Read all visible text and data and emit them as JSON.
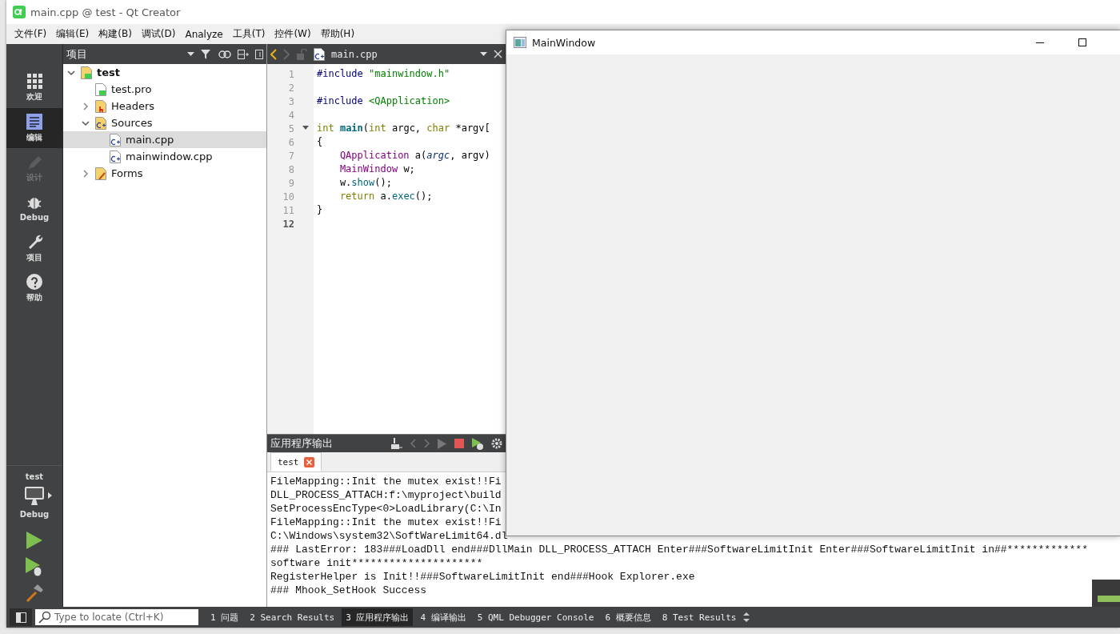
{
  "window": {
    "title": "main.cpp @ test - Qt Creator"
  },
  "menu": [
    "文件(F)",
    "编辑(E)",
    "构建(B)",
    "调试(D)",
    "Analyze",
    "工具(T)",
    "控件(W)",
    "帮助(H)"
  ],
  "mode_bar": {
    "modes": [
      {
        "label": "欢迎",
        "kind": "welcome",
        "selected": false,
        "disabled": false
      },
      {
        "label": "编辑",
        "kind": "edit",
        "selected": true,
        "disabled": false
      },
      {
        "label": "设计",
        "kind": "design",
        "selected": false,
        "disabled": true
      },
      {
        "label": "Debug",
        "kind": "debug",
        "selected": false,
        "disabled": false
      },
      {
        "label": "项目",
        "kind": "projects",
        "selected": false,
        "disabled": false
      },
      {
        "label": "帮助",
        "kind": "help",
        "selected": false,
        "disabled": false
      }
    ],
    "target": {
      "project": "test",
      "build": "Debug"
    }
  },
  "projects_pane": {
    "title": "项目",
    "tree": [
      {
        "label": "test",
        "kind": "project",
        "expanded": true,
        "selected": false,
        "children": [
          {
            "label": "test.pro",
            "kind": "pro",
            "selected": false
          },
          {
            "label": "Headers",
            "kind": "headers",
            "expanded": false,
            "selected": false
          },
          {
            "label": "Sources",
            "kind": "sources",
            "expanded": true,
            "selected": false,
            "children": [
              {
                "label": "main.cpp",
                "kind": "cpp",
                "selected": true
              },
              {
                "label": "mainwindow.cpp",
                "kind": "cpp",
                "selected": false
              }
            ]
          },
          {
            "label": "Forms",
            "kind": "forms",
            "expanded": false,
            "selected": false
          }
        ]
      }
    ]
  },
  "editor": {
    "file": "main.cpp",
    "lines": [
      {
        "number": "1",
        "current": false,
        "foldable": false,
        "tokens": [
          {
            "t": "#include ",
            "kind": "pre"
          },
          {
            "t": "\"mainwindow.h\"",
            "kind": "str"
          }
        ]
      },
      {
        "number": "2",
        "current": false,
        "foldable": false
      },
      {
        "number": "3",
        "current": false,
        "foldable": false,
        "tokens": [
          {
            "t": "#include ",
            "kind": "pre"
          },
          {
            "t": "<QApplication>",
            "kind": "str"
          }
        ]
      },
      {
        "number": "4",
        "current": false,
        "foldable": false
      },
      {
        "number": "5",
        "current": false,
        "foldable": true,
        "tokens": [
          {
            "t": "int ",
            "kind": "kw"
          },
          {
            "t": "main",
            "kind": "fn"
          },
          {
            "t": "(",
            "kind": "plain"
          },
          {
            "t": "int",
            "kind": "kw"
          },
          {
            "t": " argc, ",
            "kind": "plain"
          },
          {
            "t": "char",
            "kind": "kw"
          },
          {
            "t": " *argv[",
            "kind": "plain"
          }
        ]
      },
      {
        "number": "6",
        "current": false,
        "foldable": false,
        "tokens": [
          {
            "t": "{",
            "kind": "plain"
          }
        ]
      },
      {
        "number": "7",
        "current": false,
        "foldable": false,
        "tokens": [
          {
            "t": "    QApplication",
            "kind": "type"
          },
          {
            "t": " a(",
            "kind": "plain"
          },
          {
            "t": "argc",
            "kind": "param"
          },
          {
            "t": ", argv)",
            "kind": "plain"
          }
        ]
      },
      {
        "number": "8",
        "current": false,
        "foldable": false,
        "tokens": [
          {
            "t": "    MainWindow",
            "kind": "type"
          },
          {
            "t": " w;",
            "kind": "plain"
          }
        ]
      },
      {
        "number": "9",
        "current": false,
        "foldable": false,
        "tokens": [
          {
            "t": "    w.",
            "kind": "plain"
          },
          {
            "t": "show",
            "kind": "call"
          },
          {
            "t": "();",
            "kind": "plain"
          }
        ]
      },
      {
        "number": "10",
        "current": false,
        "foldable": false,
        "tokens": [
          {
            "t": "    return",
            "kind": "kw"
          },
          {
            "t": " a.",
            "kind": "plain"
          },
          {
            "t": "exec",
            "kind": "call"
          },
          {
            "t": "();",
            "kind": "plain"
          }
        ]
      },
      {
        "number": "11",
        "current": false,
        "foldable": false,
        "tokens": [
          {
            "t": "}",
            "kind": "plain"
          }
        ]
      },
      {
        "number": "12",
        "current": true,
        "foldable": false
      }
    ]
  },
  "output": {
    "title": "应用程序输出",
    "tabs": [
      {
        "label": "test",
        "selected": true
      }
    ],
    "lines": [
      "FileMapping::Init the mutex exist!!Fi",
      "DLL_PROCESS_ATTACH:f:\\myproject\\build",
      "SetProcessEncType<0>LoadLibrary(C:\\In",
      "FileMapping::Init the mutex exist!!Fi",
      "C:\\Windows\\system32\\SoftWareLimit64.dl",
      "### LastError: 183###LoadDll end###DllMain DLL_PROCESS_ATTACH Enter###SoftwareLimitInit Enter###SoftwareLimitInit in##*************",
      "software init*********************",
      "RegisterHelper is Init!!###SoftwareLimitInit end###Hook Explorer.exe",
      "### Mhook_SetHook Success"
    ]
  },
  "status_bar": {
    "locator": {
      "placeholder": "Type to locate (Ctrl+K)"
    },
    "panes": [
      {
        "label": "1 问题",
        "selected": false
      },
      {
        "label": "2 Search Results",
        "selected": false
      },
      {
        "label": "3 应用程序输出",
        "selected": true
      },
      {
        "label": "4 编译输出",
        "selected": false
      },
      {
        "label": "5 QML Debugger Console",
        "selected": false
      },
      {
        "label": "6 概要信息",
        "selected": false
      },
      {
        "label": "8 Test Results",
        "selected": false
      }
    ]
  },
  "app_window": {
    "title": "MainWindow"
  }
}
